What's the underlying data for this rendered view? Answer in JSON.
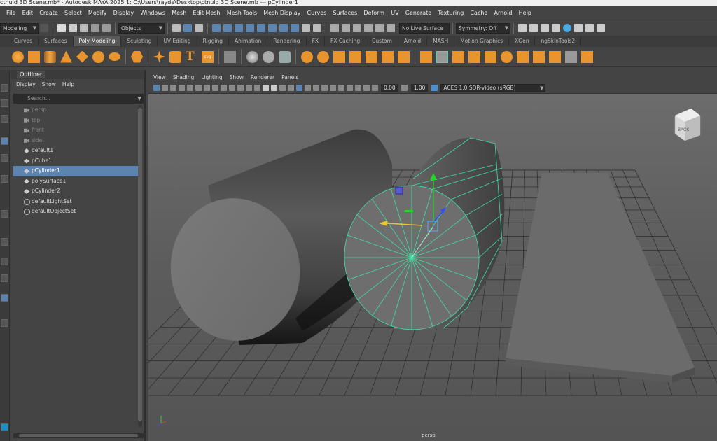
{
  "titlebar": {
    "text": "ctnuld 3D Scene.mb* - Autodesk MAYA 2025.1: C:\\Users\\rayde\\Desktop\\ctnuld 3D Scene.mb --- pCylinder1"
  },
  "menubar": [
    "File",
    "Edit",
    "Create",
    "Select",
    "Modify",
    "Display",
    "Windows",
    "Mesh",
    "Edit Mesh",
    "Mesh Tools",
    "Mesh Display",
    "Curves",
    "Surfaces",
    "Deform",
    "UV",
    "Generate",
    "Texturing",
    "Cache",
    "Arnold",
    "Help"
  ],
  "statusline": {
    "mode": "Modeling",
    "objects": "Objects",
    "live_surface": "No Live Surface",
    "symmetry": "Symmetry: Off"
  },
  "shelf_tabs": [
    "Curves",
    "Surfaces",
    "Poly Modeling",
    "Sculpting",
    "UV Editing",
    "Rigging",
    "Animation",
    "Rendering",
    "FX",
    "FX Caching",
    "Custom",
    "Arnold",
    "MASH",
    "Motion Graphics",
    "XGen",
    "ngSkinTools2"
  ],
  "shelf_active": "Poly Modeling",
  "colors": {
    "accent_orange": "#e8952f",
    "selection_blue": "#5b84b0",
    "wire_green": "#3fe0a5",
    "move_red": "#d83a3a"
  },
  "outliner": {
    "title": "Outliner",
    "menus": [
      "Display",
      "Show",
      "Help"
    ],
    "search_placeholder": "Search...",
    "items": [
      {
        "label": "persp",
        "icon": "camera-icon",
        "dim": true
      },
      {
        "label": "top",
        "icon": "camera-icon",
        "dim": true
      },
      {
        "label": "front",
        "icon": "camera-icon",
        "dim": true
      },
      {
        "label": "side",
        "icon": "camera-icon",
        "dim": true
      },
      {
        "label": "default1",
        "icon": "mesh-icon",
        "dim": false
      },
      {
        "label": "pCube1",
        "icon": "mesh-icon",
        "dim": false
      },
      {
        "label": "pCylinder1",
        "icon": "mesh-icon",
        "dim": false,
        "selected": true
      },
      {
        "label": "polySurface1",
        "icon": "mesh-icon",
        "dim": false
      },
      {
        "label": "pCylinder2",
        "icon": "mesh-icon",
        "dim": false
      },
      {
        "label": "defaultLightSet",
        "icon": "set-icon",
        "dim": false
      },
      {
        "label": "defaultObjectSet",
        "icon": "set-icon",
        "dim": false
      }
    ]
  },
  "viewport": {
    "menus": [
      "View",
      "Shading",
      "Lighting",
      "Show",
      "Renderer",
      "Panels"
    ],
    "exposure": "0.00",
    "gamma": "1.00",
    "color_space": "ACES 1.0 SDR-video (sRGB)",
    "camera_label": "persp",
    "viewcube_label": "BACK"
  }
}
